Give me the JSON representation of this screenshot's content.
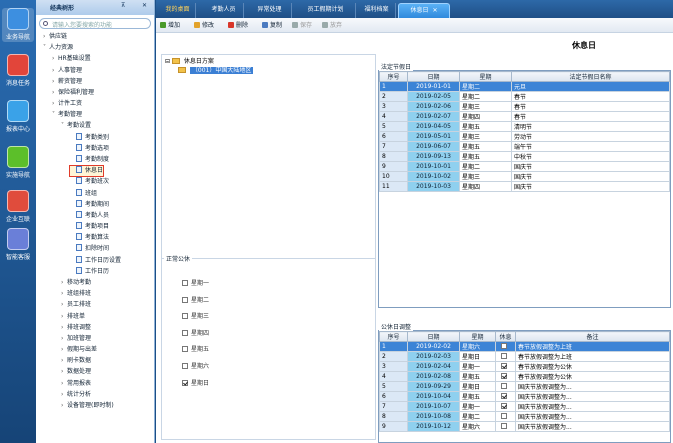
{
  "left_bar": {
    "items": [
      {
        "label": "业务导航",
        "icon": "home-icon",
        "color": "#3d8fe0"
      },
      {
        "label": "消息任务",
        "icon": "message-icon",
        "color": "#e2453a"
      },
      {
        "label": "报表中心",
        "icon": "report-icon",
        "color": "#3aa2e8"
      },
      {
        "label": "实施导航",
        "icon": "guide-icon",
        "color": "#5cbf2a"
      },
      {
        "label": "企业互联",
        "icon": "connect-icon",
        "color": "#e04c3c"
      },
      {
        "label": "智能客服",
        "icon": "service-icon",
        "color": "#6a7fd8"
      }
    ]
  },
  "nav": {
    "title": "经典树形",
    "pin_glyph": "⊼",
    "close_glyph": "✕",
    "search_placeholder": "请输入您要搜索的功能",
    "items": [
      {
        "arrow": "›",
        "label": "供应链",
        "indent": 0,
        "doc": false
      },
      {
        "arrow": "˅",
        "label": "人力资源",
        "indent": 0,
        "doc": false
      },
      {
        "arrow": "›",
        "label": "HR基础设置",
        "indent": 1,
        "doc": false
      },
      {
        "arrow": "›",
        "label": "人事管理",
        "indent": 1,
        "doc": false
      },
      {
        "arrow": "›",
        "label": "薪资管理",
        "indent": 1,
        "doc": false
      },
      {
        "arrow": "›",
        "label": "保险福利管理",
        "indent": 1,
        "doc": false
      },
      {
        "arrow": "›",
        "label": "计件工资",
        "indent": 1,
        "doc": false
      },
      {
        "arrow": "˅",
        "label": "考勤管理",
        "indent": 1,
        "doc": false
      },
      {
        "arrow": "˅",
        "label": "考勤设置",
        "indent": 2,
        "doc": false
      },
      {
        "arrow": "",
        "label": "考勤类别",
        "indent": 3,
        "doc": true
      },
      {
        "arrow": "",
        "label": "考勤选项",
        "indent": 3,
        "doc": true
      },
      {
        "arrow": "",
        "label": "考勤制度",
        "indent": 3,
        "doc": true
      },
      {
        "arrow": "",
        "label": "休息日",
        "indent": 3,
        "doc": true,
        "highlight": true
      },
      {
        "arrow": "",
        "label": "考勤班次",
        "indent": 3,
        "doc": true
      },
      {
        "arrow": "",
        "label": "班组",
        "indent": 3,
        "doc": true
      },
      {
        "arrow": "",
        "label": "考勤期间",
        "indent": 3,
        "doc": true
      },
      {
        "arrow": "",
        "label": "考勤人员",
        "indent": 3,
        "doc": true
      },
      {
        "arrow": "",
        "label": "考勤项目",
        "indent": 3,
        "doc": true
      },
      {
        "arrow": "",
        "label": "考勤算法",
        "indent": 3,
        "doc": true
      },
      {
        "arrow": "",
        "label": "扣除时间",
        "indent": 3,
        "doc": true
      },
      {
        "arrow": "",
        "label": "工作日历设置",
        "indent": 3,
        "doc": true
      },
      {
        "arrow": "",
        "label": "工作日历",
        "indent": 3,
        "doc": true
      },
      {
        "arrow": "›",
        "label": "移动考勤",
        "indent": 2,
        "doc": false
      },
      {
        "arrow": "›",
        "label": "班组排班",
        "indent": 2,
        "doc": false
      },
      {
        "arrow": "›",
        "label": "员工排班",
        "indent": 2,
        "doc": false
      },
      {
        "arrow": "›",
        "label": "排班单",
        "indent": 2,
        "doc": false
      },
      {
        "arrow": "›",
        "label": "排班调整",
        "indent": 2,
        "doc": false
      },
      {
        "arrow": "›",
        "label": "加班管理",
        "indent": 2,
        "doc": false
      },
      {
        "arrow": "›",
        "label": "假期与出差",
        "indent": 2,
        "doc": false
      },
      {
        "arrow": "›",
        "label": "刷卡数据",
        "indent": 2,
        "doc": false
      },
      {
        "arrow": "›",
        "label": "数据处理",
        "indent": 2,
        "doc": false
      },
      {
        "arrow": "›",
        "label": "常用报表",
        "indent": 2,
        "doc": false
      },
      {
        "arrow": "›",
        "label": "统计分析",
        "indent": 2,
        "doc": false
      },
      {
        "arrow": "›",
        "label": "设备管理(即时制)",
        "indent": 2,
        "doc": false
      }
    ]
  },
  "tabs": [
    {
      "label": "我的桌面",
      "first": true
    },
    {
      "label": "考勤人员"
    },
    {
      "label": "异常处理"
    },
    {
      "label": "员工假期计划"
    },
    {
      "label": "福利档案"
    },
    {
      "label": "休息日",
      "active": true,
      "close": "✕"
    }
  ],
  "toolbar": [
    {
      "label": "增加",
      "icon": "add-icon",
      "color": "#4a9a2a"
    },
    {
      "label": "修改",
      "icon": "edit-icon",
      "color": "#e2a22a"
    },
    {
      "label": "删除",
      "icon": "delete-icon",
      "color": "#d8362a"
    },
    {
      "label": "复制",
      "icon": "copy-icon",
      "color": "#4a7ac0"
    },
    {
      "label": "保存",
      "icon": "save-icon",
      "color": "#9aa",
      "disabled": true
    },
    {
      "label": "放弃",
      "icon": "cancel-icon",
      "color": "#9aa",
      "disabled": true
    }
  ],
  "page_title": "休息日",
  "scheme_tree": {
    "root": "休息日方案",
    "child": "（001）中国大陆地区",
    "expander": "⊟"
  },
  "weekday_group": {
    "title": "正常公休",
    "days": [
      {
        "label": "星期一",
        "checked": false
      },
      {
        "label": "星期二",
        "checked": false
      },
      {
        "label": "星期三",
        "checked": false
      },
      {
        "label": "星期四",
        "checked": false
      },
      {
        "label": "星期五",
        "checked": false
      },
      {
        "label": "星期六",
        "checked": false
      },
      {
        "label": "星期日",
        "checked": true
      }
    ]
  },
  "holidays": {
    "title": "法定节假日",
    "columns": [
      "序号",
      "日期",
      "星期",
      "法定节假日名称"
    ],
    "rows": [
      {
        "no": "1",
        "date": "2019-01-01",
        "weekday": "星期二",
        "name": "元旦",
        "selected": true
      },
      {
        "no": "2",
        "date": "2019-02-05",
        "weekday": "星期二",
        "name": "春节"
      },
      {
        "no": "3",
        "date": "2019-02-06",
        "weekday": "星期三",
        "name": "春节"
      },
      {
        "no": "4",
        "date": "2019-02-07",
        "weekday": "星期四",
        "name": "春节"
      },
      {
        "no": "5",
        "date": "2019-04-05",
        "weekday": "星期五",
        "name": "清明节"
      },
      {
        "no": "6",
        "date": "2019-05-01",
        "weekday": "星期三",
        "name": "劳动节"
      },
      {
        "no": "7",
        "date": "2019-06-07",
        "weekday": "星期五",
        "name": "端午节"
      },
      {
        "no": "8",
        "date": "2019-09-13",
        "weekday": "星期五",
        "name": "中秋节"
      },
      {
        "no": "9",
        "date": "2019-10-01",
        "weekday": "星期二",
        "name": "国庆节"
      },
      {
        "no": "10",
        "date": "2019-10-02",
        "weekday": "星期三",
        "name": "国庆节"
      },
      {
        "no": "11",
        "date": "2019-10-03",
        "weekday": "星期四",
        "name": "国庆节"
      }
    ]
  },
  "adjust": {
    "title": "公休日调整",
    "columns": [
      "序号",
      "日期",
      "星期",
      "休息",
      "备注"
    ],
    "rows": [
      {
        "no": "1",
        "date": "2019-02-02",
        "weekday": "星期六",
        "rest": false,
        "note": "春节放假调整为上班",
        "selected": true
      },
      {
        "no": "2",
        "date": "2019-02-03",
        "weekday": "星期日",
        "rest": false,
        "note": "春节放假调整为上班"
      },
      {
        "no": "3",
        "date": "2019-02-04",
        "weekday": "星期一",
        "rest": true,
        "note": "春节放假调整为公休"
      },
      {
        "no": "4",
        "date": "2019-02-08",
        "weekday": "星期五",
        "rest": true,
        "note": "春节放假调整为公休"
      },
      {
        "no": "5",
        "date": "2019-09-29",
        "weekday": "星期日",
        "rest": false,
        "note": "国庆节放假调整为..."
      },
      {
        "no": "6",
        "date": "2019-10-04",
        "weekday": "星期五",
        "rest": true,
        "note": "国庆节放假调整为..."
      },
      {
        "no": "7",
        "date": "2019-10-07",
        "weekday": "星期一",
        "rest": true,
        "note": "国庆节放假调整为..."
      },
      {
        "no": "8",
        "date": "2019-10-08",
        "weekday": "星期二",
        "rest": false,
        "note": "国庆节放假调整为..."
      },
      {
        "no": "9",
        "date": "2019-10-12",
        "weekday": "星期六",
        "rest": false,
        "note": "国庆节放假调整为..."
      }
    ]
  }
}
